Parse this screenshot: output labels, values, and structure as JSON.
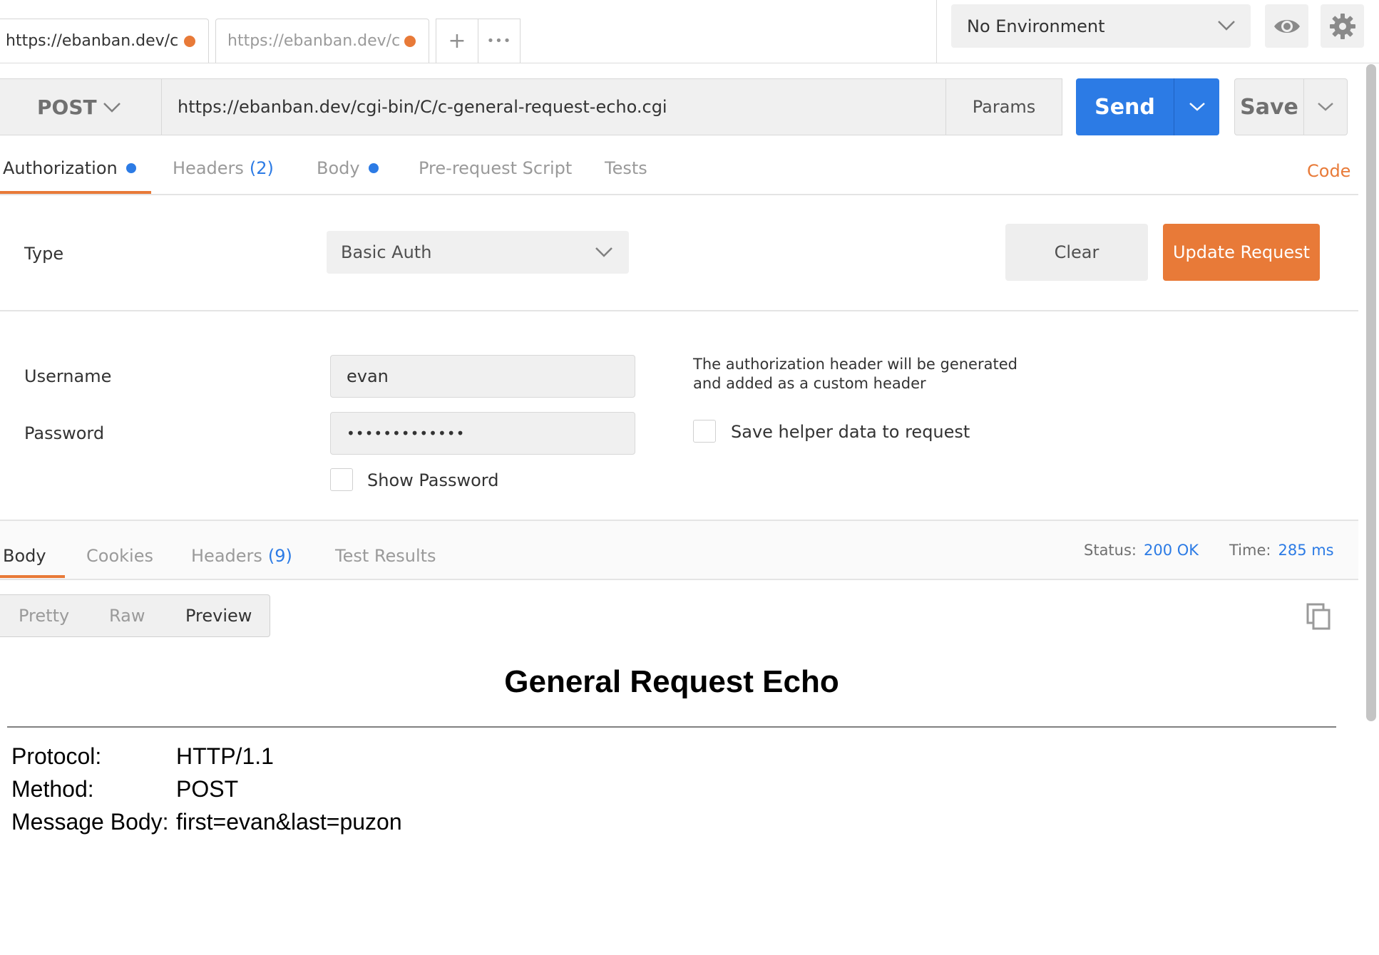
{
  "tabs": [
    {
      "label": "https://ebanban.dev/c",
      "modified": true
    },
    {
      "label": "https://ebanban.dev/c",
      "modified": true
    }
  ],
  "tab_controls": {
    "add": "+",
    "more": "•••"
  },
  "environment": {
    "selected": "No Environment"
  },
  "request": {
    "method": "POST",
    "url": "https://ebanban.dev/cgi-bin/C/c-general-request-echo.cgi",
    "params_label": "Params",
    "send_label": "Send",
    "save_label": "Save"
  },
  "request_tabs": [
    {
      "label": "Authorization",
      "dot": true
    },
    {
      "label": "Headers",
      "count": "(2)"
    },
    {
      "label": "Body",
      "dot": true
    },
    {
      "label": "Pre-request Script"
    },
    {
      "label": "Tests"
    }
  ],
  "code_link": "Code",
  "auth": {
    "type_label": "Type",
    "type_value": "Basic Auth",
    "clear_label": "Clear",
    "update_label": "Update Request",
    "username_label": "Username",
    "username_value": "evan",
    "password_label": "Password",
    "password_value": "•••••••••••••",
    "show_password_label": "Show Password",
    "helper_line1": "The authorization header will be generated",
    "helper_line2": "and added as a custom header",
    "save_helper_label": "Save helper data to request"
  },
  "response_tabs": [
    {
      "label": "Body"
    },
    {
      "label": "Cookies"
    },
    {
      "label": "Headers",
      "count": "(9)"
    },
    {
      "label": "Test Results"
    }
  ],
  "response_status": {
    "status_label": "Status:",
    "status_value": "200 OK",
    "time_label": "Time:",
    "time_value": "285 ms"
  },
  "view_modes": [
    "Pretty",
    "Raw",
    "Preview"
  ],
  "preview": {
    "title": "General Request Echo",
    "rows": [
      {
        "key": "Protocol:",
        "value": "HTTP/1.1"
      },
      {
        "key": "Method:",
        "value": "POST"
      },
      {
        "key": "Message Body:",
        "value": "first=evan&last=puzon"
      }
    ]
  },
  "colors": {
    "accent_orange": "#e87a38",
    "accent_blue": "#2c7be5"
  },
  "icons": [
    "chevron-down-icon",
    "eye-icon",
    "gear-icon",
    "copy-icon"
  ]
}
